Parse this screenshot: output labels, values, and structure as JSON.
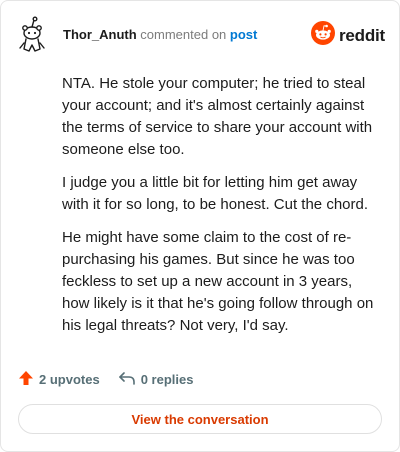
{
  "comment": {
    "username": "Thor_Anuth",
    "action_text": "commented on",
    "post_link_label": "post",
    "paragraphs": [
      "NTA. He stole your computer; he tried to steal your account; and it's almost certainly against the terms of service to share your account with someone else too.",
      "I judge you a little bit for letting him get away with it for so long, to be honest. Cut the chord.",
      "He might have some claim to the cost of re-purchasing his games. But since he was too feckless to set up a new account in 3 years, how likely is it that he's going follow through on his legal threats? Not very, I'd say."
    ]
  },
  "brand": {
    "wordmark": "reddit",
    "icon": "reddit-snoo-icon",
    "color": "#ff4500"
  },
  "stats": {
    "upvotes_label": "2 upvotes",
    "replies_label": "0 replies",
    "upvote_icon": "upvote-arrow-icon",
    "reply_icon": "reply-arrow-icon",
    "upvote_color": "#ff4500"
  },
  "cta": {
    "label": "View the conversation",
    "color": "#d93a00"
  }
}
